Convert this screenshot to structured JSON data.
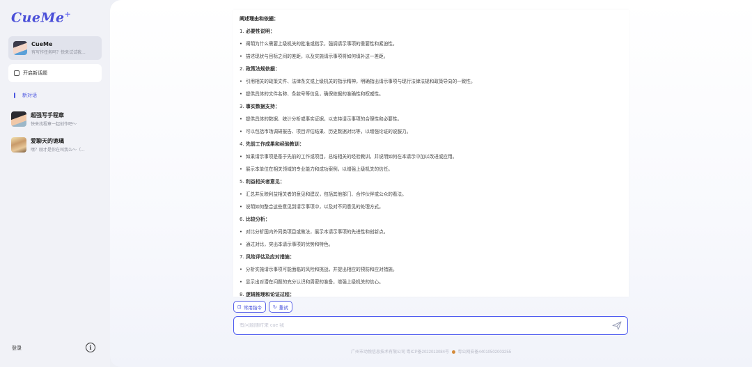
{
  "app": {
    "logo": "CueMe",
    "logo_mark": "+"
  },
  "sidebar": {
    "active_bot": {
      "name": "CueMe",
      "subtitle": "有写作任务吗？快来试试我..."
    },
    "new_topic_label": "开启新话题",
    "new_chat_label": "新对话",
    "history": [
      {
        "name": "超强写手程章",
        "subtitle": "快来找程章一起创作吧～"
      },
      {
        "name": "爱聊天的诡璃",
        "subtitle": "嘿？刚才是你在叫我么～（..."
      }
    ],
    "login_label": "登录",
    "info_label": "i"
  },
  "content": {
    "lines": [
      {
        "type": "heading",
        "text": "阐述理由和依据："
      },
      {
        "type": "num",
        "n": "1. ",
        "text": "必要性说明："
      },
      {
        "type": "bullet",
        "text": "阐明为什么需要上级机关的批准或指示，强调请示事项的重要性和紧迫性。"
      },
      {
        "type": "bullet",
        "text": "描述现状与目标之间的差距，以及实施请示事项将如何填补这一差距。"
      },
      {
        "type": "num",
        "n": "2. ",
        "text": "政策法规依据："
      },
      {
        "type": "bullet",
        "text": "引用相关的政策文件、法律条文或上级机关的指示精神，明确指出请示事项与现行法律法规和政策导向的一致性。"
      },
      {
        "type": "bullet",
        "text": "提供具体的文件名称、条款号等信息，确保依据的准确性和权威性。"
      },
      {
        "type": "num",
        "n": "3. ",
        "text": "事实数据支持："
      },
      {
        "type": "bullet",
        "text": "提供具体的数据、统计分析或事实证据，以支持请示事项的合理性和必要性。"
      },
      {
        "type": "bullet",
        "text": "可以包括市场调研报告、项目评估结果、历史数据对比等，以增强论证的说服力。"
      },
      {
        "type": "num",
        "n": "4. ",
        "text": "先前工作成果和经验教训："
      },
      {
        "type": "bullet",
        "text": "如果请示事项是基于先前的工作或项目，总结相关的经验教训，并说明如何在本请示中加以改进或应用。"
      },
      {
        "type": "bullet",
        "text": "展示本单位在相关领域的专业能力和成功案例，以增强上级机关的信任。"
      },
      {
        "type": "num",
        "n": "5. ",
        "text": "利益相关者意见："
      },
      {
        "type": "bullet",
        "text": "汇总并反映利益相关者的意见和建议，包括其他部门、合作伙伴或公众的看法。"
      },
      {
        "type": "bullet",
        "text": "说明如何整合这些意见到请示事项中，以及对不同意见的处理方式。"
      },
      {
        "type": "num",
        "n": "6. ",
        "text": "比较分析："
      },
      {
        "type": "bullet",
        "text": "对比分析国内外同类项目或做法，展示本请示事项的先进性和创新点。"
      },
      {
        "type": "bullet",
        "text": "通过对比，突出本请示事项的优势和特色。"
      },
      {
        "type": "num",
        "n": "7. ",
        "text": "风险评估及应对措施："
      },
      {
        "type": "bullet",
        "text": "分析实施请示事项可能面临的风险和挑战，并提出相应的预防和应对措施。"
      },
      {
        "type": "bullet",
        "text": "显示出对潜在问题的充分认识和周密的准备，增强上级机关的信心。"
      },
      {
        "type": "num",
        "n": "8. ",
        "text": "逻辑推理和论证过程："
      }
    ]
  },
  "toolbar": {
    "common_commands": "常用指令",
    "retry": "重试"
  },
  "input": {
    "placeholder": "有问题随时来 cue 我"
  },
  "footer": {
    "company": "广州市动悦信息技术有限公司 粤ICP备2022013084号",
    "police": "粤公网安备44010502003255"
  },
  "colors": {
    "accent": "#4f5cf0",
    "sidebar_bg": "#f1f2f7"
  }
}
